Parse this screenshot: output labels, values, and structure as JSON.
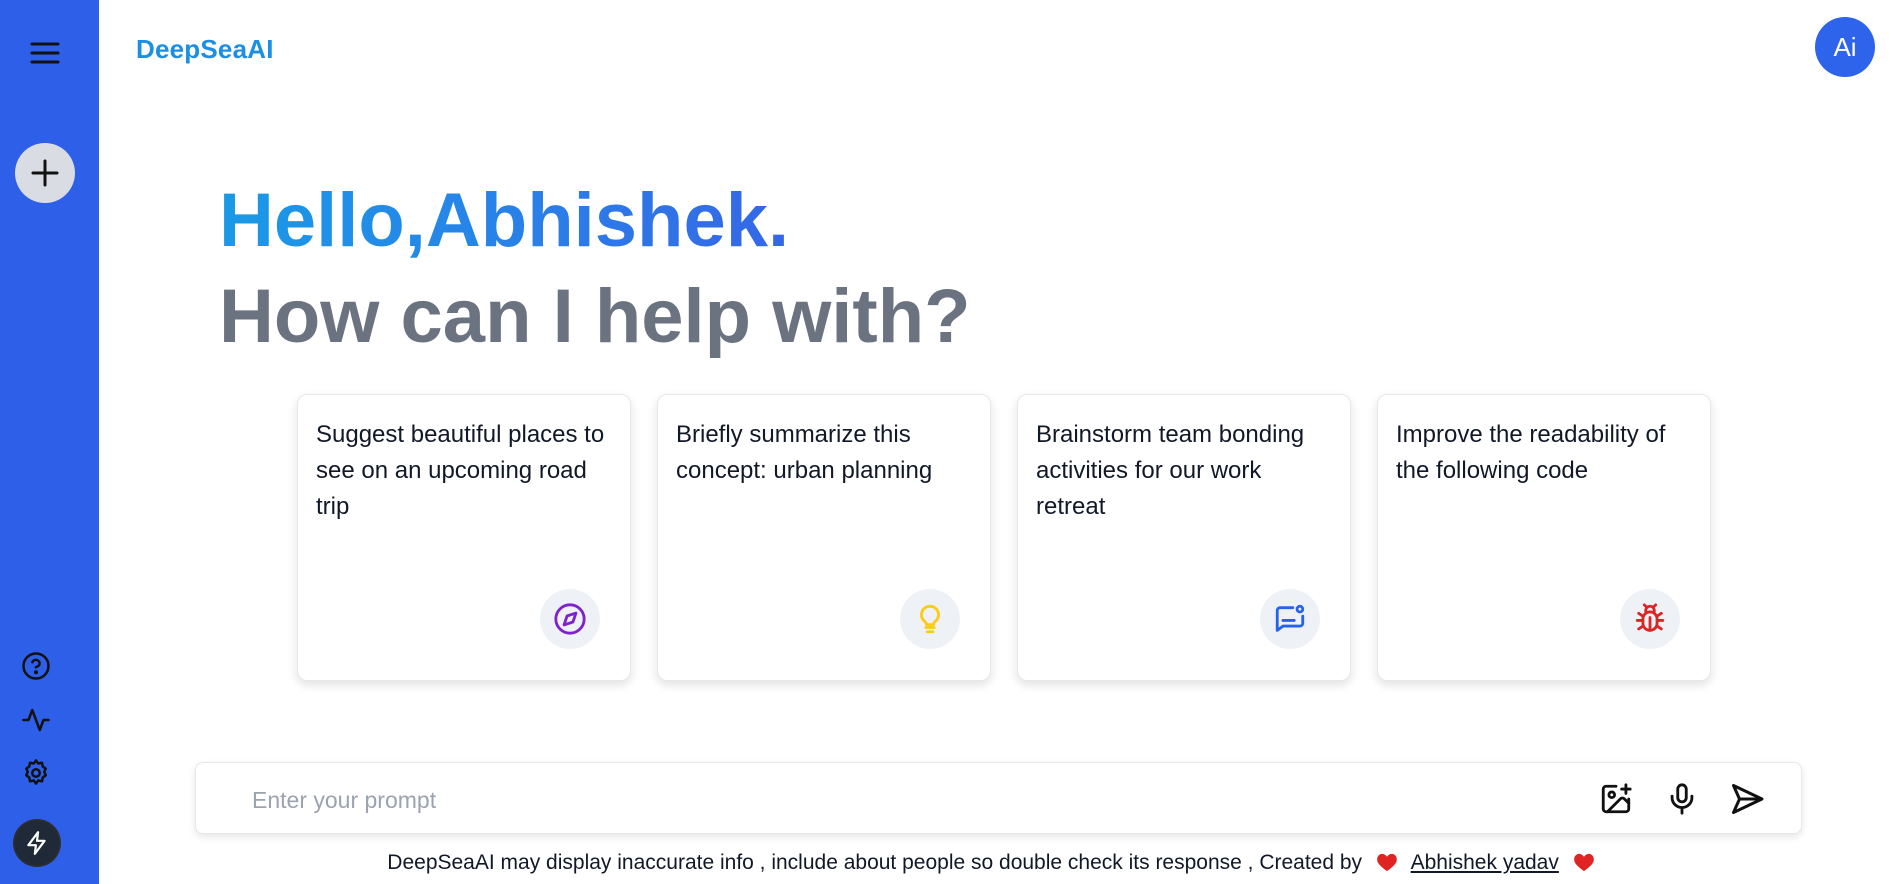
{
  "brand": {
    "name": "DeepSeaAI"
  },
  "avatar": {
    "label": "Ai"
  },
  "greeting": {
    "hello": "Hello,Abhishek.",
    "subtitle": "How can I help with?"
  },
  "cards": [
    {
      "text": "Suggest beautiful places to see on an upcoming road trip",
      "icon": "compass-icon",
      "icon_color": "#7e22ce"
    },
    {
      "text": "Briefly summarize this concept: urban planning",
      "icon": "lightbulb-icon",
      "icon_color": "#facc15"
    },
    {
      "text": "Brainstorm team bonding activities for our work retreat",
      "icon": "message-icon",
      "icon_color": "#2563eb"
    },
    {
      "text": "Improve the readability of the following code",
      "icon": "bug-icon",
      "icon_color": "#dc2626"
    }
  ],
  "prompt": {
    "placeholder": "Enter your prompt",
    "value": ""
  },
  "footer": {
    "text": "DeepSeaAI may display inaccurate info , include about people so double check its response , Created by",
    "author": "Abhishek yadav"
  },
  "colors": {
    "sidebar": "#2e5fe8",
    "brand": "#1a8fe3",
    "avatar": "#2e64ec",
    "subtitle": "#6b7280"
  }
}
